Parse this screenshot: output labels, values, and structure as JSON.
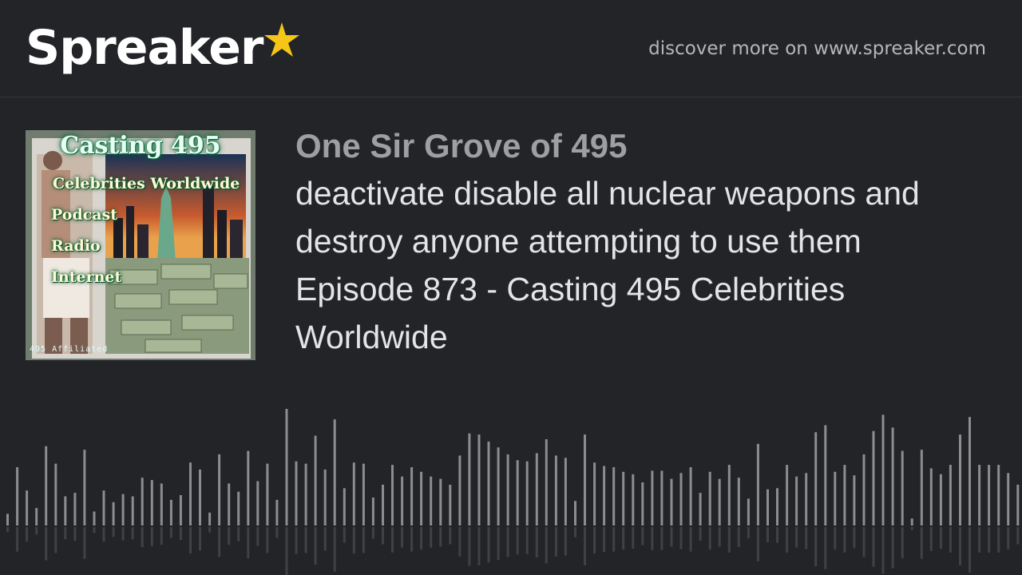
{
  "header": {
    "logo_text": "Spreaker",
    "discover_text": "discover more on www.spreaker.com"
  },
  "cover": {
    "title": "Casting 495",
    "lines": [
      "Celebrities Worldwide",
      "Podcast",
      "Radio",
      "Internet"
    ],
    "badge": "495 Affiliated"
  },
  "episode": {
    "show": "One Sir Grove of 495",
    "title": "deactivate disable all nuclear weapons and destroy anyone attempting to use them Episode 873 - Casting 495 Celebrities Worldwide"
  },
  "waveform": {
    "color": "#8c8d90",
    "levels": [
      0.1,
      0.5,
      0.3,
      0.15,
      0.68,
      0.53,
      0.25,
      0.28,
      0.65,
      0.12,
      0.3,
      0.2,
      0.27,
      0.25,
      0.41,
      0.39,
      0.36,
      0.22,
      0.26,
      0.54,
      0.48,
      0.11,
      0.61,
      0.36,
      0.29,
      0.64,
      0.38,
      0.53,
      0.22,
      1.0,
      0.55,
      0.53,
      0.77,
      0.48,
      0.91,
      0.32,
      0.54,
      0.53,
      0.24,
      0.35,
      0.52,
      0.42,
      0.5,
      0.46,
      0.42,
      0.4,
      0.35,
      0.6,
      0.79,
      0.78,
      0.72,
      0.67,
      0.61,
      0.56,
      0.55,
      0.62,
      0.74,
      0.6,
      0.58,
      0.21,
      0.78,
      0.54,
      0.51,
      0.5,
      0.46,
      0.44,
      0.37,
      0.47,
      0.47,
      0.4,
      0.45,
      0.5,
      0.28,
      0.46,
      0.4,
      0.52,
      0.41,
      0.23,
      0.7,
      0.31,
      0.32,
      0.52,
      0.42,
      0.45,
      0.8,
      0.86,
      0.46,
      0.52,
      0.43,
      0.61,
      0.81,
      0.95,
      0.84,
      0.64,
      0.06,
      0.65,
      0.49,
      0.44,
      0.52,
      0.78,
      0.93,
      0.52,
      0.52,
      0.52,
      0.45,
      0.35
    ]
  }
}
